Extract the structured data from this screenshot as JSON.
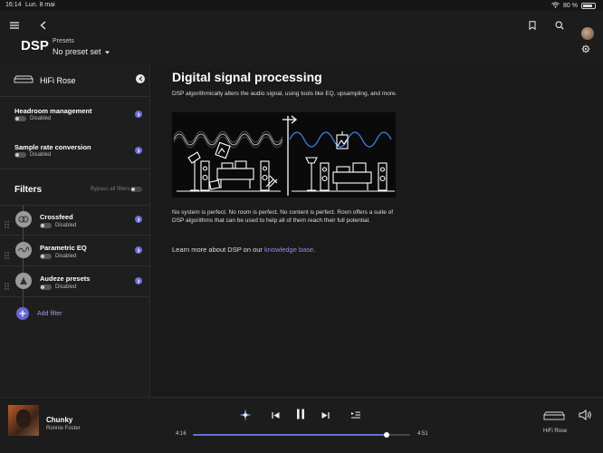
{
  "statusbar": {
    "time": "16:14",
    "date": "Lun. 8 mai",
    "battery": "80 %"
  },
  "header": {
    "title": "DSP",
    "presets_label": "Presets",
    "presets_value": "No preset set"
  },
  "sidebar": {
    "device_name": "HiFi Rose",
    "settings": [
      {
        "title": "Headroom management",
        "status": "Disabled"
      },
      {
        "title": "Sample rate conversion",
        "status": "Disabled"
      }
    ],
    "filters_title": "Filters",
    "bypass_label": "Bypass all filters",
    "filters": [
      {
        "name": "Crossfeed",
        "status": "Disabled"
      },
      {
        "name": "Parametric EQ",
        "status": "Disabled"
      },
      {
        "name": "Audeze presets",
        "status": "Disabled"
      }
    ],
    "add_filter_label": "Add filter"
  },
  "main": {
    "heading": "Digital signal processing",
    "intro": "DSP algorithmically alters the audio signal, using tools like EQ, upsampling, and more.",
    "body": "No system is perfect. No room is perfect. No content is perfect. Roon offers a suite of DSP algorithms that can be used to help all of them reach their full potential.",
    "learn_prefix": "Learn more about DSP on our ",
    "learn_link": "knowledge base",
    "learn_suffix": "."
  },
  "player": {
    "track": "Chunky",
    "artist": "Ronnie Foster",
    "elapsed": "4:16",
    "total": "4:51",
    "progress": 0.89,
    "zone": "HiFi Rose"
  },
  "colors": {
    "accent": "#6b6bd8",
    "link": "#8d8df0",
    "wave_before": "#bbbbbb",
    "wave_after": "#3f7fe0"
  }
}
